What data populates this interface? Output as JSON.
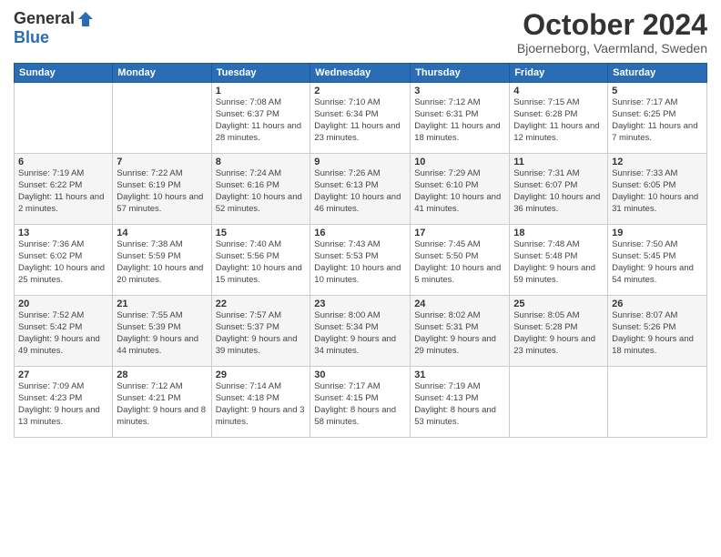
{
  "logo": {
    "general": "General",
    "blue": "Blue"
  },
  "title": "October 2024",
  "location": "Bjoerneborg, Vaermland, Sweden",
  "headers": [
    "Sunday",
    "Monday",
    "Tuesday",
    "Wednesday",
    "Thursday",
    "Friday",
    "Saturday"
  ],
  "weeks": [
    [
      {
        "day": "",
        "info": ""
      },
      {
        "day": "",
        "info": ""
      },
      {
        "day": "1",
        "info": "Sunrise: 7:08 AM\nSunset: 6:37 PM\nDaylight: 11 hours and 28 minutes."
      },
      {
        "day": "2",
        "info": "Sunrise: 7:10 AM\nSunset: 6:34 PM\nDaylight: 11 hours and 23 minutes."
      },
      {
        "day": "3",
        "info": "Sunrise: 7:12 AM\nSunset: 6:31 PM\nDaylight: 11 hours and 18 minutes."
      },
      {
        "day": "4",
        "info": "Sunrise: 7:15 AM\nSunset: 6:28 PM\nDaylight: 11 hours and 12 minutes."
      },
      {
        "day": "5",
        "info": "Sunrise: 7:17 AM\nSunset: 6:25 PM\nDaylight: 11 hours and 7 minutes."
      }
    ],
    [
      {
        "day": "6",
        "info": "Sunrise: 7:19 AM\nSunset: 6:22 PM\nDaylight: 11 hours and 2 minutes."
      },
      {
        "day": "7",
        "info": "Sunrise: 7:22 AM\nSunset: 6:19 PM\nDaylight: 10 hours and 57 minutes."
      },
      {
        "day": "8",
        "info": "Sunrise: 7:24 AM\nSunset: 6:16 PM\nDaylight: 10 hours and 52 minutes."
      },
      {
        "day": "9",
        "info": "Sunrise: 7:26 AM\nSunset: 6:13 PM\nDaylight: 10 hours and 46 minutes."
      },
      {
        "day": "10",
        "info": "Sunrise: 7:29 AM\nSunset: 6:10 PM\nDaylight: 10 hours and 41 minutes."
      },
      {
        "day": "11",
        "info": "Sunrise: 7:31 AM\nSunset: 6:07 PM\nDaylight: 10 hours and 36 minutes."
      },
      {
        "day": "12",
        "info": "Sunrise: 7:33 AM\nSunset: 6:05 PM\nDaylight: 10 hours and 31 minutes."
      }
    ],
    [
      {
        "day": "13",
        "info": "Sunrise: 7:36 AM\nSunset: 6:02 PM\nDaylight: 10 hours and 25 minutes."
      },
      {
        "day": "14",
        "info": "Sunrise: 7:38 AM\nSunset: 5:59 PM\nDaylight: 10 hours and 20 minutes."
      },
      {
        "day": "15",
        "info": "Sunrise: 7:40 AM\nSunset: 5:56 PM\nDaylight: 10 hours and 15 minutes."
      },
      {
        "day": "16",
        "info": "Sunrise: 7:43 AM\nSunset: 5:53 PM\nDaylight: 10 hours and 10 minutes."
      },
      {
        "day": "17",
        "info": "Sunrise: 7:45 AM\nSunset: 5:50 PM\nDaylight: 10 hours and 5 minutes."
      },
      {
        "day": "18",
        "info": "Sunrise: 7:48 AM\nSunset: 5:48 PM\nDaylight: 9 hours and 59 minutes."
      },
      {
        "day": "19",
        "info": "Sunrise: 7:50 AM\nSunset: 5:45 PM\nDaylight: 9 hours and 54 minutes."
      }
    ],
    [
      {
        "day": "20",
        "info": "Sunrise: 7:52 AM\nSunset: 5:42 PM\nDaylight: 9 hours and 49 minutes."
      },
      {
        "day": "21",
        "info": "Sunrise: 7:55 AM\nSunset: 5:39 PM\nDaylight: 9 hours and 44 minutes."
      },
      {
        "day": "22",
        "info": "Sunrise: 7:57 AM\nSunset: 5:37 PM\nDaylight: 9 hours and 39 minutes."
      },
      {
        "day": "23",
        "info": "Sunrise: 8:00 AM\nSunset: 5:34 PM\nDaylight: 9 hours and 34 minutes."
      },
      {
        "day": "24",
        "info": "Sunrise: 8:02 AM\nSunset: 5:31 PM\nDaylight: 9 hours and 29 minutes."
      },
      {
        "day": "25",
        "info": "Sunrise: 8:05 AM\nSunset: 5:28 PM\nDaylight: 9 hours and 23 minutes."
      },
      {
        "day": "26",
        "info": "Sunrise: 8:07 AM\nSunset: 5:26 PM\nDaylight: 9 hours and 18 minutes."
      }
    ],
    [
      {
        "day": "27",
        "info": "Sunrise: 7:09 AM\nSunset: 4:23 PM\nDaylight: 9 hours and 13 minutes."
      },
      {
        "day": "28",
        "info": "Sunrise: 7:12 AM\nSunset: 4:21 PM\nDaylight: 9 hours and 8 minutes."
      },
      {
        "day": "29",
        "info": "Sunrise: 7:14 AM\nSunset: 4:18 PM\nDaylight: 9 hours and 3 minutes."
      },
      {
        "day": "30",
        "info": "Sunrise: 7:17 AM\nSunset: 4:15 PM\nDaylight: 8 hours and 58 minutes."
      },
      {
        "day": "31",
        "info": "Sunrise: 7:19 AM\nSunset: 4:13 PM\nDaylight: 8 hours and 53 minutes."
      },
      {
        "day": "",
        "info": ""
      },
      {
        "day": "",
        "info": ""
      }
    ]
  ]
}
